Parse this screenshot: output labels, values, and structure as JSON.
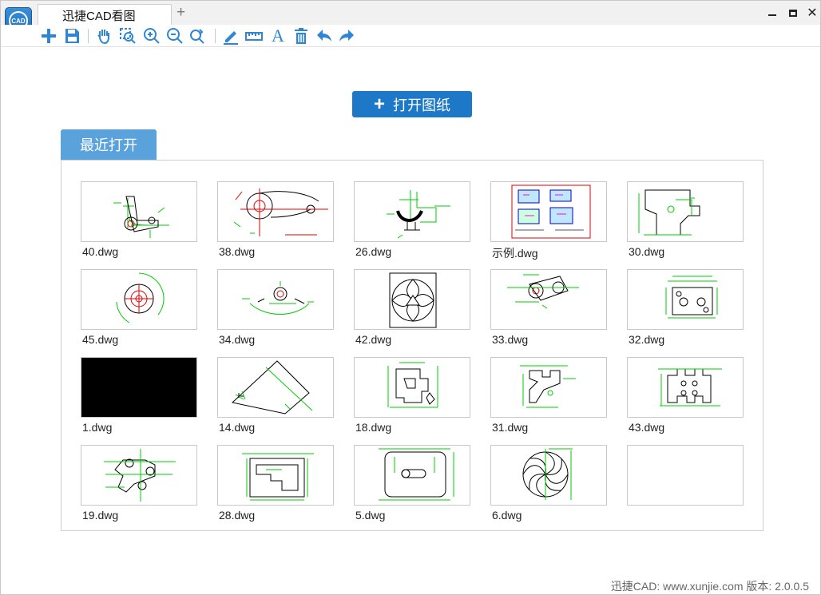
{
  "window": {
    "tab_title": "迅捷CAD看图",
    "new_tab_glyph": "+",
    "close_glyph": "✕"
  },
  "toolbar": {
    "icons": [
      "plus-icon",
      "save-icon",
      "pan-hand-icon",
      "zoom-window-icon",
      "zoom-in-icon",
      "zoom-out-icon",
      "zoom-extents-icon",
      "markup-pen-icon",
      "measure-ruler-icon",
      "text-icon",
      "delete-icon",
      "undo-icon",
      "redo-icon"
    ],
    "text_glyph": "A"
  },
  "main": {
    "open_button_label": "打开图纸",
    "open_button_glyph": "+",
    "recent_tab_label": "最近打开",
    "files": [
      {
        "name": "40.dwg"
      },
      {
        "name": "38.dwg"
      },
      {
        "name": "26.dwg"
      },
      {
        "name": "示例.dwg"
      },
      {
        "name": "30.dwg"
      },
      {
        "name": "45.dwg"
      },
      {
        "name": "34.dwg"
      },
      {
        "name": "42.dwg"
      },
      {
        "name": "33.dwg"
      },
      {
        "name": "32.dwg"
      },
      {
        "name": "1.dwg"
      },
      {
        "name": "14.dwg"
      },
      {
        "name": "18.dwg"
      },
      {
        "name": "31.dwg"
      },
      {
        "name": "43.dwg"
      },
      {
        "name": "19.dwg"
      },
      {
        "name": "28.dwg"
      },
      {
        "name": "5.dwg"
      },
      {
        "name": "6.dwg"
      },
      {
        "name": ""
      }
    ]
  },
  "footer": {
    "text": "迅捷CAD: www.xunjie.com 版本: 2.0.0.5"
  },
  "colors": {
    "accent": "#1e78c8",
    "tab_blue": "#5aa2dc",
    "icon_blue": "#2f86d4",
    "cad_green": "#00cc00",
    "cad_red": "#e00000"
  }
}
